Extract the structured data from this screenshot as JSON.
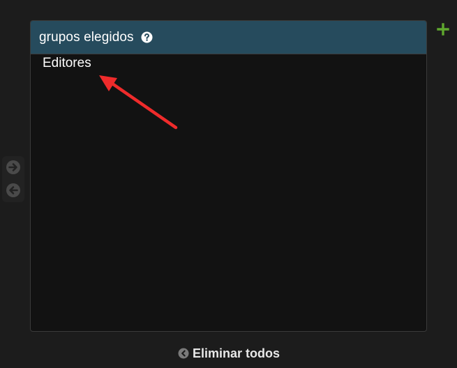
{
  "selector": {
    "title": "grupos elegidos",
    "help_icon": "question-circle-icon",
    "options": [
      "Editores"
    ]
  },
  "chooser": {
    "add_icon": "arrow-right-circle-icon",
    "remove_icon": "arrow-left-circle-icon"
  },
  "add_link_icon": "plus-icon",
  "remove_all": {
    "icon": "chevron-left-circle-icon",
    "label": "Eliminar todos"
  },
  "annotation": {
    "icon": "red-pointer-arrow",
    "color": "#ef2b2b"
  },
  "colors": {
    "header_bg": "#264b5d",
    "panel_bg": "#121212",
    "page_bg": "#1c1c1c",
    "add_green": "#5fa82e"
  }
}
